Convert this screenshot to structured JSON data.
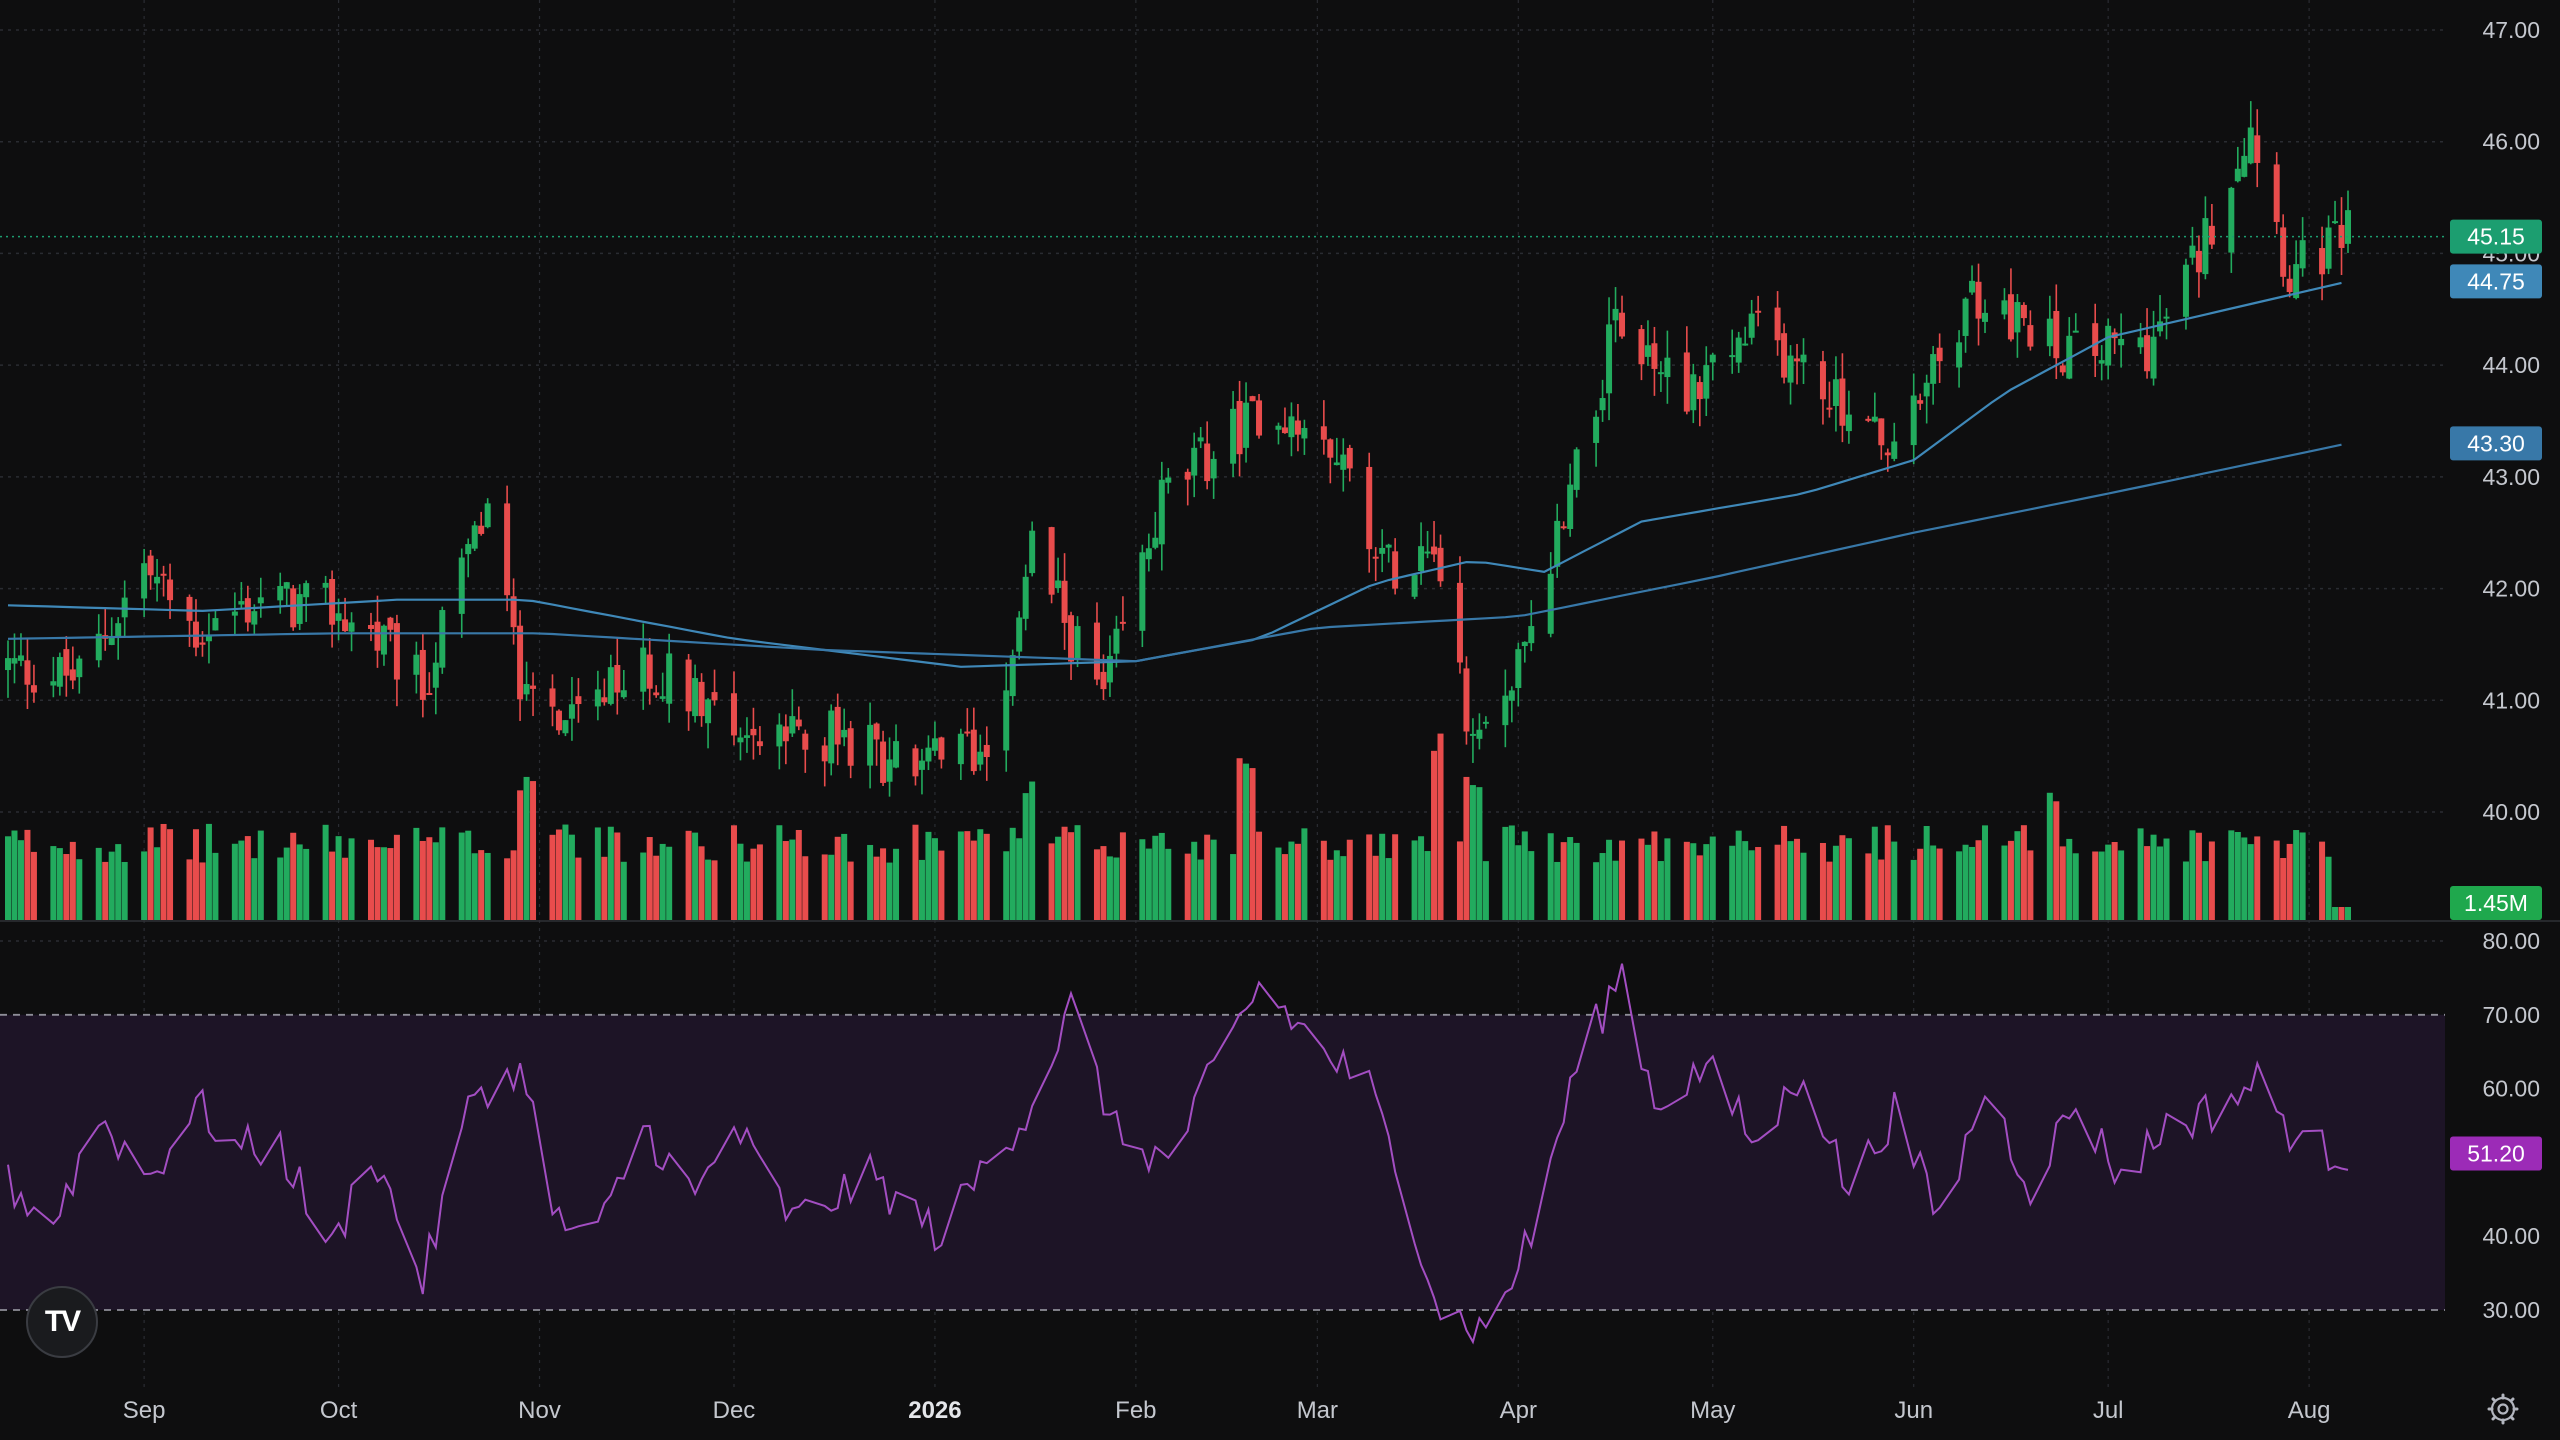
{
  "colors": {
    "background": "#0e0e0f",
    "up": "#22ab5e",
    "down": "#e84c4c",
    "ma50": "#3f88b8",
    "ma200": "#3878a8",
    "rsi_line": "#a34ec2",
    "rsi_band": "#1d1426",
    "grid": "#2a2c32",
    "last_price_badge": "#1c9e70",
    "volume_badge": "#1fa84d",
    "rsi_badge": "#9c2bb7"
  },
  "icons": {
    "logo": "tradingview-logo",
    "logo_text": "TV",
    "settings": "gear-icon"
  },
  "chart_data": [
    {
      "type": "candlestick",
      "name": "price",
      "x_range": [
        "2025-08-11",
        "2026-08-07"
      ],
      "ylim": [
        39.0,
        47.3
      ],
      "y_ticks": [
        "40.00",
        "41.00",
        "42.00",
        "43.00",
        "44.00",
        "45.00",
        "46.00",
        "47.00"
      ],
      "x_ticks": [
        "Sep",
        "Oct",
        "Nov",
        "Dec",
        "2026",
        "Feb",
        "Mar",
        "Apr",
        "May",
        "Jun",
        "Jul",
        "Aug"
      ],
      "close_path": {
        "dates": [
          "2025-08-11",
          "2025-08-22",
          "2025-09-01",
          "2025-09-09",
          "2025-09-19",
          "2025-09-30",
          "2025-10-06",
          "2025-10-14",
          "2025-10-21",
          "2025-10-24",
          "2025-10-30",
          "2025-11-07",
          "2025-11-17",
          "2025-11-26",
          "2025-12-05",
          "2025-12-15",
          "2025-12-29",
          "2026-01-09",
          "2026-01-16",
          "2026-01-27",
          "2026-02-05",
          "2026-02-20",
          "2026-03-02",
          "2026-03-12",
          "2026-03-19",
          "2026-03-25",
          "2026-04-02",
          "2026-04-10",
          "2026-04-16",
          "2026-04-27",
          "2026-05-08",
          "2026-05-22",
          "2026-05-29",
          "2026-06-10",
          "2026-06-19",
          "2026-06-26",
          "2026-07-08",
          "2026-07-15",
          "2026-07-23",
          "2026-07-29",
          "2026-08-07"
        ],
        "close": [
          41.3,
          41.2,
          42.2,
          41.6,
          41.9,
          41.8,
          41.6,
          41.1,
          42.3,
          42.7,
          40.9,
          40.8,
          41.3,
          41.1,
          40.6,
          40.7,
          40.4,
          40.6,
          42.3,
          41.0,
          42.8,
          43.6,
          43.5,
          42.2,
          42.5,
          40.5,
          41.4,
          43.2,
          44.3,
          43.8,
          44.3,
          43.6,
          43.2,
          44.6,
          44.3,
          44.1,
          44.2,
          45.0,
          46.2,
          44.8,
          45.15
        ]
      },
      "last_price": "45.15",
      "ma50_path": {
        "dates": [
          "2025-08-11",
          "2025-09-10",
          "2025-10-10",
          "2025-10-30",
          "2025-12-01",
          "2026-01-05",
          "2026-02-01",
          "2026-02-20",
          "2026-03-10",
          "2026-03-25",
          "2026-04-05",
          "2026-04-20",
          "2026-05-15",
          "2026-06-01",
          "2026-06-15",
          "2026-07-01",
          "2026-08-07"
        ],
        "values": [
          41.85,
          41.8,
          41.9,
          41.9,
          41.55,
          41.3,
          41.35,
          41.55,
          42.05,
          42.25,
          42.15,
          42.6,
          42.85,
          43.15,
          43.75,
          44.25,
          44.75
        ]
      },
      "ma50_last": "44.75",
      "ma200_path": {
        "dates": [
          "2025-08-11",
          "2025-10-01",
          "2025-11-01",
          "2025-12-15",
          "2026-02-01",
          "2026-03-01",
          "2026-04-01",
          "2026-05-01",
          "2026-06-01",
          "2026-07-01",
          "2026-08-07"
        ],
        "values": [
          41.55,
          41.6,
          41.6,
          41.45,
          41.35,
          41.65,
          41.75,
          42.1,
          42.5,
          42.85,
          43.3
        ]
      },
      "ma200_last": "43.30"
    },
    {
      "type": "bar",
      "name": "volume",
      "note_scale": "relative to max in view",
      "spikes": [
        {
          "date": "2025-10-30",
          "value": 0.55
        },
        {
          "date": "2026-01-16",
          "value": 0.52
        },
        {
          "date": "2026-02-18",
          "value": 0.6
        },
        {
          "date": "2026-03-20",
          "value": 0.72
        },
        {
          "date": "2026-03-25",
          "value": 0.55
        },
        {
          "date": "2026-06-22",
          "value": 0.5
        }
      ],
      "last_volume": "1.45M"
    },
    {
      "type": "line",
      "name": "RSI",
      "ylim": [
        22,
        81
      ],
      "y_ticks": [
        "30.00",
        "40.00",
        "50.00",
        "60.00",
        "70.00",
        "80.00"
      ],
      "band": [
        30,
        70
      ],
      "path": {
        "dates": [
          "2025-08-11",
          "2025-08-18",
          "2025-08-25",
          "2025-09-02",
          "2025-09-09",
          "2025-09-15",
          "2025-09-22",
          "2025-09-30",
          "2025-10-06",
          "2025-10-14",
          "2025-10-22",
          "2025-10-30",
          "2025-11-03",
          "2025-11-10",
          "2025-11-17",
          "2025-11-25",
          "2025-12-01",
          "2025-12-10",
          "2025-12-22",
          "2026-01-02",
          "2026-01-09",
          "2026-01-16",
          "2026-01-22",
          "2026-01-29",
          "2026-02-06",
          "2026-02-13",
          "2026-02-20",
          "2026-03-02",
          "2026-03-09",
          "2026-03-16",
          "2026-03-20",
          "2026-03-27",
          "2026-04-03",
          "2026-04-10",
          "2026-04-17",
          "2026-04-22",
          "2026-04-30",
          "2026-05-08",
          "2026-05-15",
          "2026-05-22",
          "2026-05-29",
          "2026-06-05",
          "2026-06-12",
          "2026-06-19",
          "2026-06-26",
          "2026-07-03",
          "2026-07-10",
          "2026-07-17",
          "2026-07-24",
          "2026-07-31",
          "2026-08-07"
        ],
        "values": [
          47,
          42,
          56,
          48,
          58,
          52,
          52,
          38,
          52,
          34,
          60,
          62,
          42,
          40,
          55,
          45,
          55,
          42,
          48,
          40,
          50,
          58,
          71,
          54,
          50,
          62,
          74,
          65,
          60,
          42,
          30,
          27,
          40,
          63,
          76,
          58,
          63,
          52,
          63,
          46,
          57,
          42,
          60,
          47,
          58,
          48,
          55,
          57,
          61,
          52,
          51.2
        ]
      },
      "last_value": "51.20"
    }
  ]
}
